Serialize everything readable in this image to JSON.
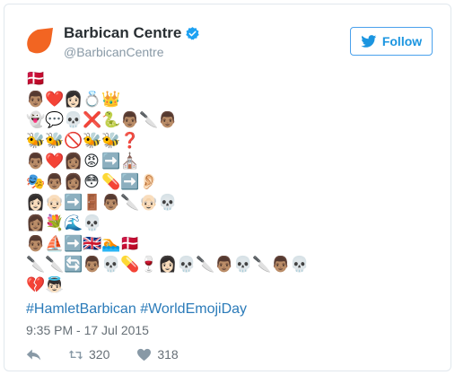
{
  "account": {
    "display_name": "Barbican Centre",
    "handle": "@BarbicanCentre",
    "brand_color": "#f26522",
    "verified": true
  },
  "follow_button": {
    "label": "Follow",
    "icon": "twitter-bird-icon",
    "color": "#1b95e0"
  },
  "tweet": {
    "emoji_lines": [
      [
        "🇩🇰"
      ],
      [
        "👨🏽",
        "❤️",
        "👩🏻",
        "💍",
        "👑"
      ],
      [
        "👻",
        "💬",
        "💀",
        "❌",
        "🐍",
        "👨🏽",
        "🔪",
        "👨🏽"
      ],
      [
        "🐝",
        "🐝",
        "🚫",
        "🐝",
        "🐝",
        "❓"
      ],
      [
        "👨🏽",
        "❤️",
        "👩🏽",
        "😡",
        "➡️",
        "⛪"
      ],
      [
        "🎭",
        "👨🏽",
        "👩🏽",
        "😳",
        "💊",
        "➡️",
        "👂🏻"
      ],
      [
        "👩🏻",
        "👴🏻",
        "➡️",
        "🚪",
        "👨🏽",
        "🔪",
        "👴🏻",
        "💀"
      ],
      [
        "👩🏽",
        "💐",
        "🌊",
        "💀"
      ],
      [
        "👨🏽",
        "⛵",
        "➡️",
        "🇬🇧",
        "🏊",
        "🇩🇰"
      ],
      [
        "🔪",
        "🔪",
        "🔄",
        "👨🏽",
        "💀",
        "💊",
        "🍷",
        "👩🏻",
        "💀",
        "🔪",
        "👨🏽",
        "💀",
        "🔪",
        "👨🏽",
        "💀"
      ],
      [
        "💔",
        "👼🏻"
      ]
    ],
    "hashtags": [
      "#HamletBarbican",
      "#WorldEmojiDay"
    ],
    "timestamp": "9:35 PM - 17 Jul 2015"
  },
  "actions": {
    "reply_icon": "reply-icon",
    "retweet_icon": "retweet-icon",
    "retweet_count": "320",
    "like_icon": "heart-icon",
    "like_count": "318"
  }
}
